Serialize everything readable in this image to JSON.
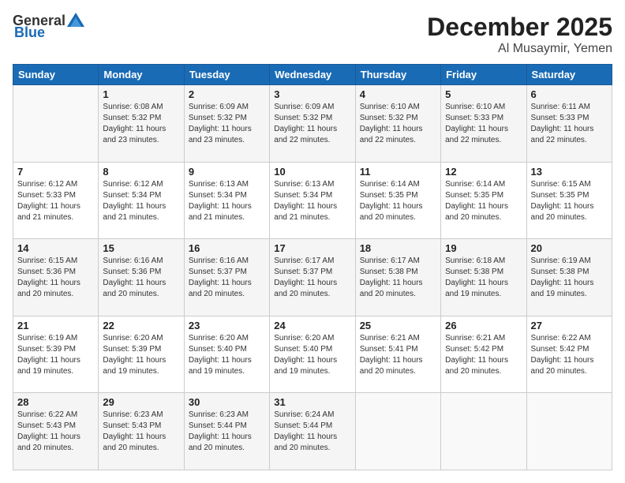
{
  "header": {
    "logo_general": "General",
    "logo_blue": "Blue",
    "month": "December 2025",
    "location": "Al Musaymir, Yemen"
  },
  "days_of_week": [
    "Sunday",
    "Monday",
    "Tuesday",
    "Wednesday",
    "Thursday",
    "Friday",
    "Saturday"
  ],
  "weeks": [
    {
      "days": [
        {
          "num": "",
          "info": ""
        },
        {
          "num": "1",
          "info": "Sunrise: 6:08 AM\nSunset: 5:32 PM\nDaylight: 11 hours\nand 23 minutes."
        },
        {
          "num": "2",
          "info": "Sunrise: 6:09 AM\nSunset: 5:32 PM\nDaylight: 11 hours\nand 23 minutes."
        },
        {
          "num": "3",
          "info": "Sunrise: 6:09 AM\nSunset: 5:32 PM\nDaylight: 11 hours\nand 22 minutes."
        },
        {
          "num": "4",
          "info": "Sunrise: 6:10 AM\nSunset: 5:32 PM\nDaylight: 11 hours\nand 22 minutes."
        },
        {
          "num": "5",
          "info": "Sunrise: 6:10 AM\nSunset: 5:33 PM\nDaylight: 11 hours\nand 22 minutes."
        },
        {
          "num": "6",
          "info": "Sunrise: 6:11 AM\nSunset: 5:33 PM\nDaylight: 11 hours\nand 22 minutes."
        }
      ],
      "shade": true
    },
    {
      "days": [
        {
          "num": "7",
          "info": "Sunrise: 6:12 AM\nSunset: 5:33 PM\nDaylight: 11 hours\nand 21 minutes."
        },
        {
          "num": "8",
          "info": "Sunrise: 6:12 AM\nSunset: 5:34 PM\nDaylight: 11 hours\nand 21 minutes."
        },
        {
          "num": "9",
          "info": "Sunrise: 6:13 AM\nSunset: 5:34 PM\nDaylight: 11 hours\nand 21 minutes."
        },
        {
          "num": "10",
          "info": "Sunrise: 6:13 AM\nSunset: 5:34 PM\nDaylight: 11 hours\nand 21 minutes."
        },
        {
          "num": "11",
          "info": "Sunrise: 6:14 AM\nSunset: 5:35 PM\nDaylight: 11 hours\nand 20 minutes."
        },
        {
          "num": "12",
          "info": "Sunrise: 6:14 AM\nSunset: 5:35 PM\nDaylight: 11 hours\nand 20 minutes."
        },
        {
          "num": "13",
          "info": "Sunrise: 6:15 AM\nSunset: 5:35 PM\nDaylight: 11 hours\nand 20 minutes."
        }
      ],
      "shade": false
    },
    {
      "days": [
        {
          "num": "14",
          "info": "Sunrise: 6:15 AM\nSunset: 5:36 PM\nDaylight: 11 hours\nand 20 minutes."
        },
        {
          "num": "15",
          "info": "Sunrise: 6:16 AM\nSunset: 5:36 PM\nDaylight: 11 hours\nand 20 minutes."
        },
        {
          "num": "16",
          "info": "Sunrise: 6:16 AM\nSunset: 5:37 PM\nDaylight: 11 hours\nand 20 minutes."
        },
        {
          "num": "17",
          "info": "Sunrise: 6:17 AM\nSunset: 5:37 PM\nDaylight: 11 hours\nand 20 minutes."
        },
        {
          "num": "18",
          "info": "Sunrise: 6:17 AM\nSunset: 5:38 PM\nDaylight: 11 hours\nand 20 minutes."
        },
        {
          "num": "19",
          "info": "Sunrise: 6:18 AM\nSunset: 5:38 PM\nDaylight: 11 hours\nand 19 minutes."
        },
        {
          "num": "20",
          "info": "Sunrise: 6:19 AM\nSunset: 5:38 PM\nDaylight: 11 hours\nand 19 minutes."
        }
      ],
      "shade": true
    },
    {
      "days": [
        {
          "num": "21",
          "info": "Sunrise: 6:19 AM\nSunset: 5:39 PM\nDaylight: 11 hours\nand 19 minutes."
        },
        {
          "num": "22",
          "info": "Sunrise: 6:20 AM\nSunset: 5:39 PM\nDaylight: 11 hours\nand 19 minutes."
        },
        {
          "num": "23",
          "info": "Sunrise: 6:20 AM\nSunset: 5:40 PM\nDaylight: 11 hours\nand 19 minutes."
        },
        {
          "num": "24",
          "info": "Sunrise: 6:20 AM\nSunset: 5:40 PM\nDaylight: 11 hours\nand 19 minutes."
        },
        {
          "num": "25",
          "info": "Sunrise: 6:21 AM\nSunset: 5:41 PM\nDaylight: 11 hours\nand 20 minutes."
        },
        {
          "num": "26",
          "info": "Sunrise: 6:21 AM\nSunset: 5:42 PM\nDaylight: 11 hours\nand 20 minutes."
        },
        {
          "num": "27",
          "info": "Sunrise: 6:22 AM\nSunset: 5:42 PM\nDaylight: 11 hours\nand 20 minutes."
        }
      ],
      "shade": false
    },
    {
      "days": [
        {
          "num": "28",
          "info": "Sunrise: 6:22 AM\nSunset: 5:43 PM\nDaylight: 11 hours\nand 20 minutes."
        },
        {
          "num": "29",
          "info": "Sunrise: 6:23 AM\nSunset: 5:43 PM\nDaylight: 11 hours\nand 20 minutes."
        },
        {
          "num": "30",
          "info": "Sunrise: 6:23 AM\nSunset: 5:44 PM\nDaylight: 11 hours\nand 20 minutes."
        },
        {
          "num": "31",
          "info": "Sunrise: 6:24 AM\nSunset: 5:44 PM\nDaylight: 11 hours\nand 20 minutes."
        },
        {
          "num": "",
          "info": ""
        },
        {
          "num": "",
          "info": ""
        },
        {
          "num": "",
          "info": ""
        }
      ],
      "shade": true
    }
  ]
}
